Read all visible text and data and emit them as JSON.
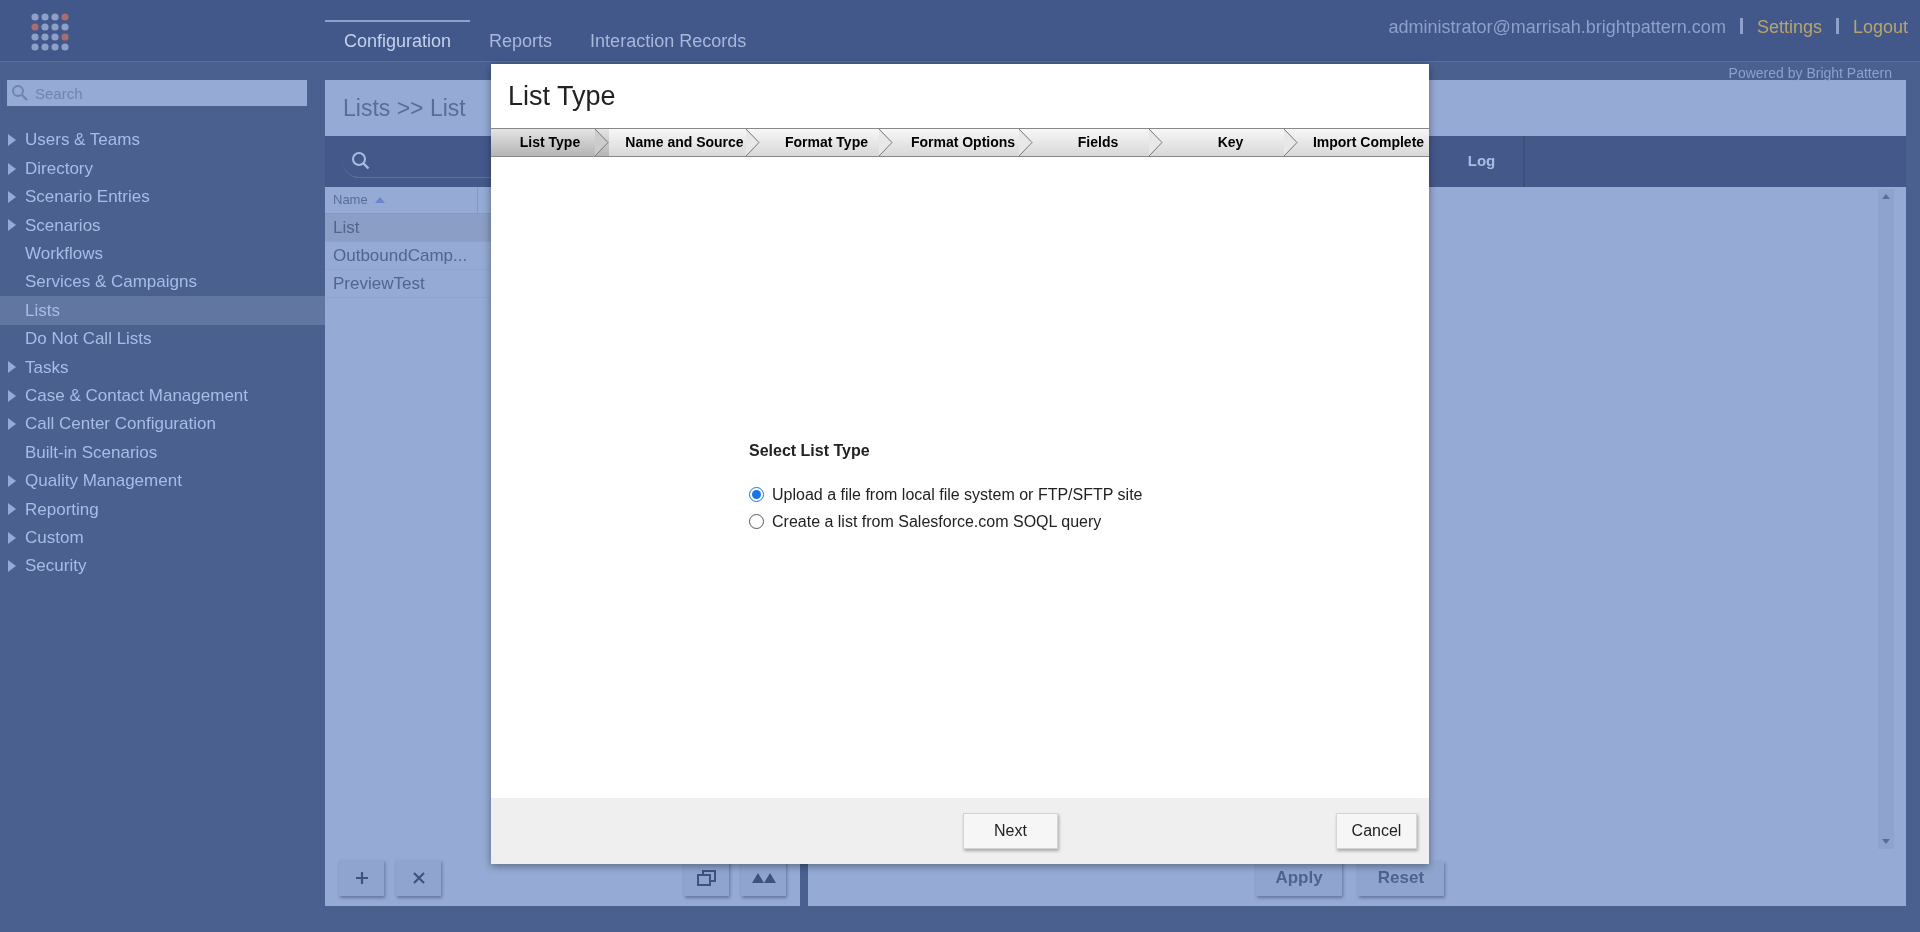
{
  "header": {
    "nav_tabs": [
      {
        "label": "Configuration",
        "selected": true
      },
      {
        "label": "Reports",
        "selected": false
      },
      {
        "label": "Interaction Records",
        "selected": false
      }
    ],
    "user": "administrator@marrisah.brightpattern.com",
    "links": [
      "Settings",
      "Logout"
    ],
    "powered_by": "Powered by Bright Pattern"
  },
  "sidebar": {
    "search": {
      "placeholder": "Search"
    },
    "items": [
      {
        "label": "Users & Teams",
        "expandable": true,
        "selected": false
      },
      {
        "label": "Directory",
        "expandable": true,
        "selected": false
      },
      {
        "label": "Scenario Entries",
        "expandable": true,
        "selected": false
      },
      {
        "label": "Scenarios",
        "expandable": true,
        "selected": false
      },
      {
        "label": "Workflows",
        "expandable": false,
        "selected": false
      },
      {
        "label": "Services & Campaigns",
        "expandable": false,
        "selected": false
      },
      {
        "label": "Lists",
        "expandable": false,
        "selected": true
      },
      {
        "label": "Do Not Call Lists",
        "expandable": false,
        "selected": false
      },
      {
        "label": "Tasks",
        "expandable": true,
        "selected": false
      },
      {
        "label": "Case & Contact Management",
        "expandable": true,
        "selected": false
      },
      {
        "label": "Call Center Configuration",
        "expandable": true,
        "selected": false
      },
      {
        "label": "Built-in Scenarios",
        "expandable": false,
        "selected": false
      },
      {
        "label": "Quality Management",
        "expandable": true,
        "selected": false
      },
      {
        "label": "Reporting",
        "expandable": true,
        "selected": false
      },
      {
        "label": "Custom",
        "expandable": true,
        "selected": false
      },
      {
        "label": "Security",
        "expandable": true,
        "selected": false
      }
    ]
  },
  "page": {
    "breadcrumb": "Lists >> List",
    "list_table": {
      "columns": [
        {
          "label": "Name",
          "sorted_ascending": true
        }
      ],
      "rows": [
        {
          "name": "List",
          "selected": true
        },
        {
          "name": "OutboundCamp...",
          "selected": false
        },
        {
          "name": "PreviewTest",
          "selected": false
        }
      ]
    },
    "detail_tabs": [
      {
        "label": "Log"
      }
    ],
    "left_buttons": [
      {
        "kind": "add"
      },
      {
        "kind": "delete"
      },
      {
        "kind": "duplicate"
      },
      {
        "kind": "move-up"
      }
    ],
    "right_buttons": [
      "Apply",
      "Reset"
    ]
  },
  "dialog": {
    "title": "List Type",
    "steps": [
      {
        "label": "List Type",
        "selected": true
      },
      {
        "label": "Name and Source",
        "selected": false
      },
      {
        "label": "Format Type",
        "selected": false
      },
      {
        "label": "Format Options",
        "selected": false
      },
      {
        "label": "Fields",
        "selected": false
      },
      {
        "label": "Key",
        "selected": false
      },
      {
        "label": "Import Complete",
        "selected": false
      }
    ],
    "section_title": "Select List Type",
    "options": [
      {
        "label": "Upload a file from local file system or FTP/SFTP site",
        "selected": true
      },
      {
        "label": "Create a list from Salesforce.com SOQL query",
        "selected": false
      }
    ],
    "buttons": [
      "Next",
      "Cancel"
    ]
  }
}
